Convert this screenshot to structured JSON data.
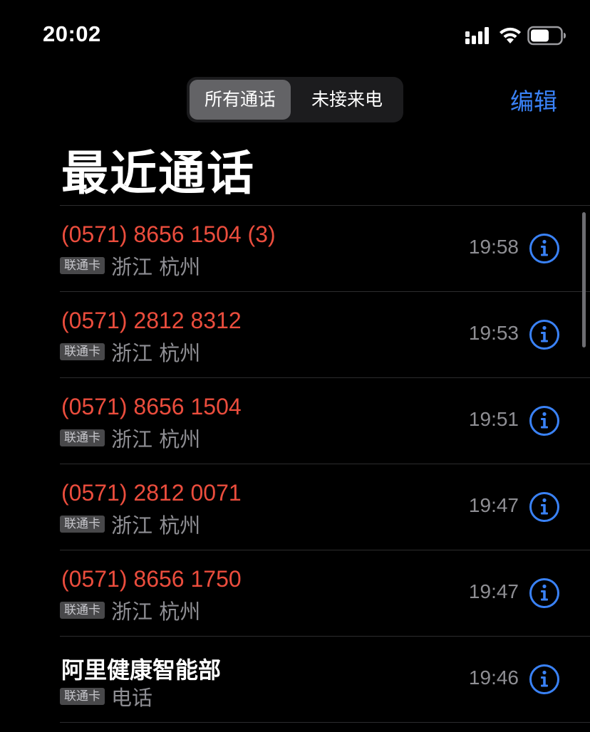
{
  "status_bar": {
    "time": "20:02"
  },
  "segmented_control": {
    "all_label": "所有通话",
    "missed_label": "未接来电",
    "selected": "all"
  },
  "edit_label": "编辑",
  "title": "最近通话",
  "colors": {
    "missed": "#eb4d3d",
    "accent": "#3a82f7",
    "secondary_text": "#8e8e93"
  },
  "calls": [
    {
      "name": "(0571) 8656 1504 (3)",
      "missed": true,
      "sim": "联通卡",
      "location": "浙江 杭州",
      "time": "19:58"
    },
    {
      "name": "(0571) 2812 8312",
      "missed": true,
      "sim": "联通卡",
      "location": "浙江 杭州",
      "time": "19:53"
    },
    {
      "name": "(0571) 8656 1504",
      "missed": true,
      "sim": "联通卡",
      "location": "浙江 杭州",
      "time": "19:51"
    },
    {
      "name": "(0571) 2812 0071",
      "missed": true,
      "sim": "联通卡",
      "location": "浙江 杭州",
      "time": "19:47"
    },
    {
      "name": "(0571) 8656 1750",
      "missed": true,
      "sim": "联通卡",
      "location": "浙江 杭州",
      "time": "19:47"
    },
    {
      "name": "阿里健康智能部",
      "missed": false,
      "sim": "联通卡",
      "location": "电话",
      "time": "19:46"
    }
  ]
}
